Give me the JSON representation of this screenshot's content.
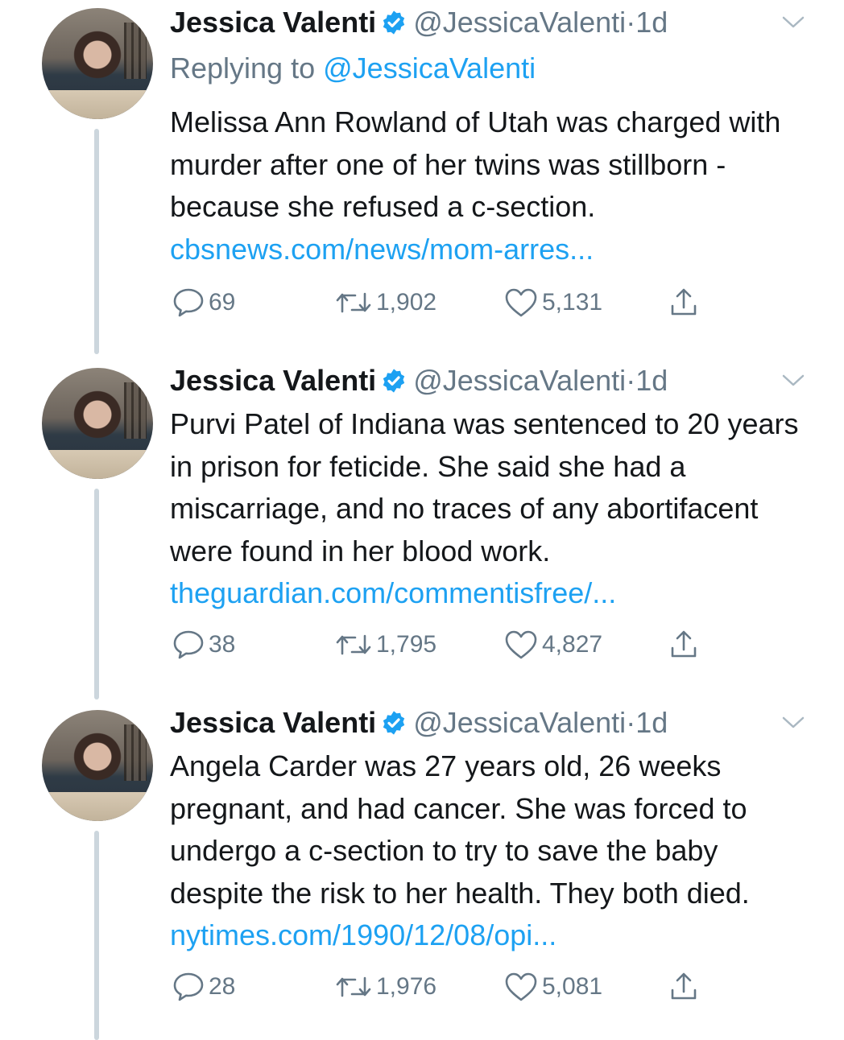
{
  "author": {
    "name": "Jessica Valenti",
    "handle": "@JessicaValenti"
  },
  "tweets": [
    {
      "time": "1d",
      "replying_label": "Replying to",
      "replying_to": "@JessicaValenti",
      "text": "Melissa Ann Rowland of Utah was charged with murder after one of her twins was stillborn - because she refused a c-section. ",
      "link": "cbsnews.com/news/mom-arres...",
      "replies": "69",
      "retweets": "1,902",
      "likes": "5,131"
    },
    {
      "time": "1d",
      "text": "Purvi Patel of Indiana was sentenced to 20 years in prison for feticide. She said she had a miscarriage, and no traces of any abortifacent were found in her blood work. ",
      "link": "theguardian.com/commentisfree/...",
      "replies": "38",
      "retweets": "1,795",
      "likes": "4,827"
    },
    {
      "time": "1d",
      "text": "Angela Carder was 27 years old, 26 weeks pregnant, and had cancer. She was forced to undergo a c-section to try to save the baby despite the risk to her health. They both died. ",
      "link": "nytimes.com/1990/12/08/opi...",
      "replies": "28",
      "retweets": "1,976",
      "likes": "5,081"
    }
  ],
  "separator": "·",
  "colors": {
    "link": "#1da1f2",
    "muted": "#657786",
    "text": "#14171a",
    "thread_line": "#ccd6dd",
    "verified": "#1da1f2"
  },
  "icons": [
    "verified-badge-icon",
    "chevron-down-icon",
    "reply-icon",
    "retweet-icon",
    "like-icon",
    "share-icon"
  ]
}
